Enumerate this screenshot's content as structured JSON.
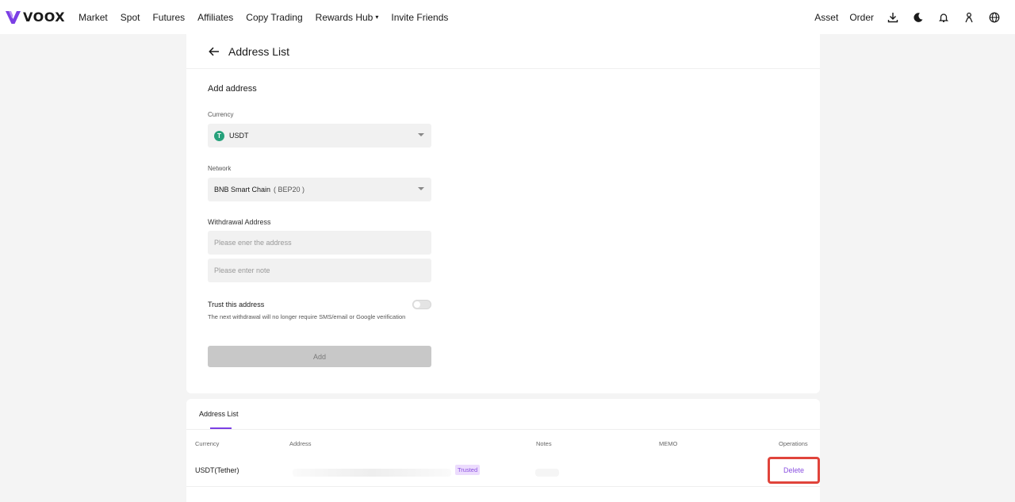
{
  "nav": {
    "brand": "VOOX",
    "links": [
      "Market",
      "Spot",
      "Futures",
      "Affiliates",
      "Copy Trading",
      "Rewards Hub",
      "Invite Friends"
    ],
    "right_links": [
      "Asset",
      "Order"
    ],
    "icons": [
      "download-icon",
      "moon-icon",
      "bell-icon",
      "user-icon",
      "globe-icon"
    ]
  },
  "page": {
    "title": "Address List"
  },
  "form": {
    "section_title": "Add address",
    "currency_label": "Currency",
    "currency_value": "USDT",
    "currency_icon_letter": "T",
    "network_label": "Network",
    "network_value": "BNB Smart Chain",
    "network_sub": "( BEP20 )",
    "withdraw_label": "Withdrawal Address",
    "address_placeholder": "Please ener the address",
    "note_placeholder": "Please enter note",
    "trust_title": "Trust this address",
    "trust_desc": "The next withdrawal will no longer require SMS/email or Google verification",
    "add_button": "Add"
  },
  "list": {
    "tab": "Address List",
    "columns": [
      "Currency",
      "Address",
      "Notes",
      "MEMO",
      "Operations"
    ],
    "rows": [
      {
        "currency": "USDT(Tether)",
        "badge": "Trusted",
        "operation": "Delete"
      }
    ]
  },
  "colors": {
    "accent": "#7b3fe4",
    "highlight": "#e0443b",
    "tether": "#26a17b"
  }
}
